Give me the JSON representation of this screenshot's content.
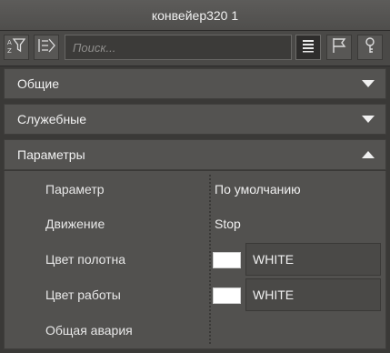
{
  "window": {
    "title": "конвейер320 1"
  },
  "toolbar": {
    "search_placeholder": "Поиск...",
    "icons": [
      "sort-filter-icon",
      "filter-icon",
      "list-view-icon",
      "flag-icon",
      "key-icon"
    ]
  },
  "sections": [
    {
      "label": "Общие",
      "state": "collapsed"
    },
    {
      "label": "Служебные",
      "state": "collapsed"
    },
    {
      "label": "Параметры",
      "state": "expanded"
    }
  ],
  "params": {
    "rows": [
      {
        "label": "Параметр",
        "value": "По умолчанию"
      },
      {
        "label": "Движение",
        "value": "Stop"
      },
      {
        "label": "Цвет полотна",
        "value": "WHITE",
        "swatch": "#ffffff"
      },
      {
        "label": "Цвет работы",
        "value": "WHITE",
        "swatch": "#ffffff"
      },
      {
        "label": "Общая авария",
        "value": ""
      }
    ]
  }
}
